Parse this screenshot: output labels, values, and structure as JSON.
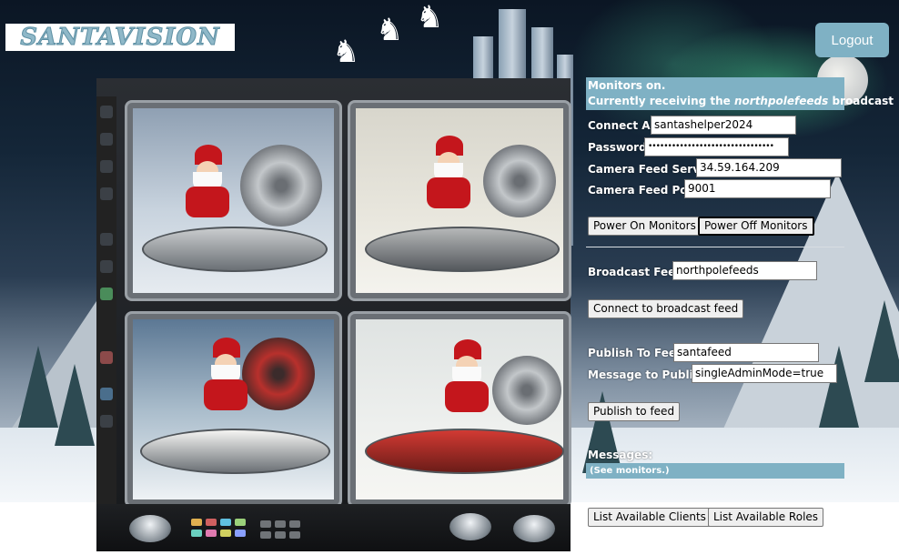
{
  "app": {
    "logo_text": "SANTAVISION"
  },
  "header": {
    "logout_label": "Logout"
  },
  "status": {
    "line1": "Monitors on.",
    "line2_prefix": "Currently receiving the ",
    "line2_feed": "northpolefeeds",
    "line2_suffix": " broadcast"
  },
  "connection": {
    "connect_as_label": "Connect As:",
    "connect_as_value": "santashelper2024",
    "password_label": "Password:",
    "password_value": "••••••••••••••••••••••••••••••••",
    "server_label": "Camera Feed Server:",
    "server_value": "34.59.164.209",
    "port_label": "Camera Feed Port:",
    "port_value": "9001"
  },
  "monitor_buttons": {
    "power_on": "Power On Monitors",
    "power_off": "Power Off Monitors"
  },
  "broadcast": {
    "label": "Broadcast Feed:",
    "value": "northpolefeeds",
    "connect_button": "Connect to broadcast feed"
  },
  "publish": {
    "feed_label": "Publish To Feed:",
    "feed_value": "santafeed",
    "message_label": "Message to Publish:",
    "message_value": "singleAdminMode=true",
    "publish_button": "Publish to feed"
  },
  "messages": {
    "label": "Messages:",
    "content": "(See monitors.)"
  },
  "footer_buttons": {
    "list_clients": "List Available Clients",
    "list_roles": "List Available Roles"
  },
  "colors": {
    "accent": "#7fb1c4",
    "logo": "#8fb8c8"
  }
}
